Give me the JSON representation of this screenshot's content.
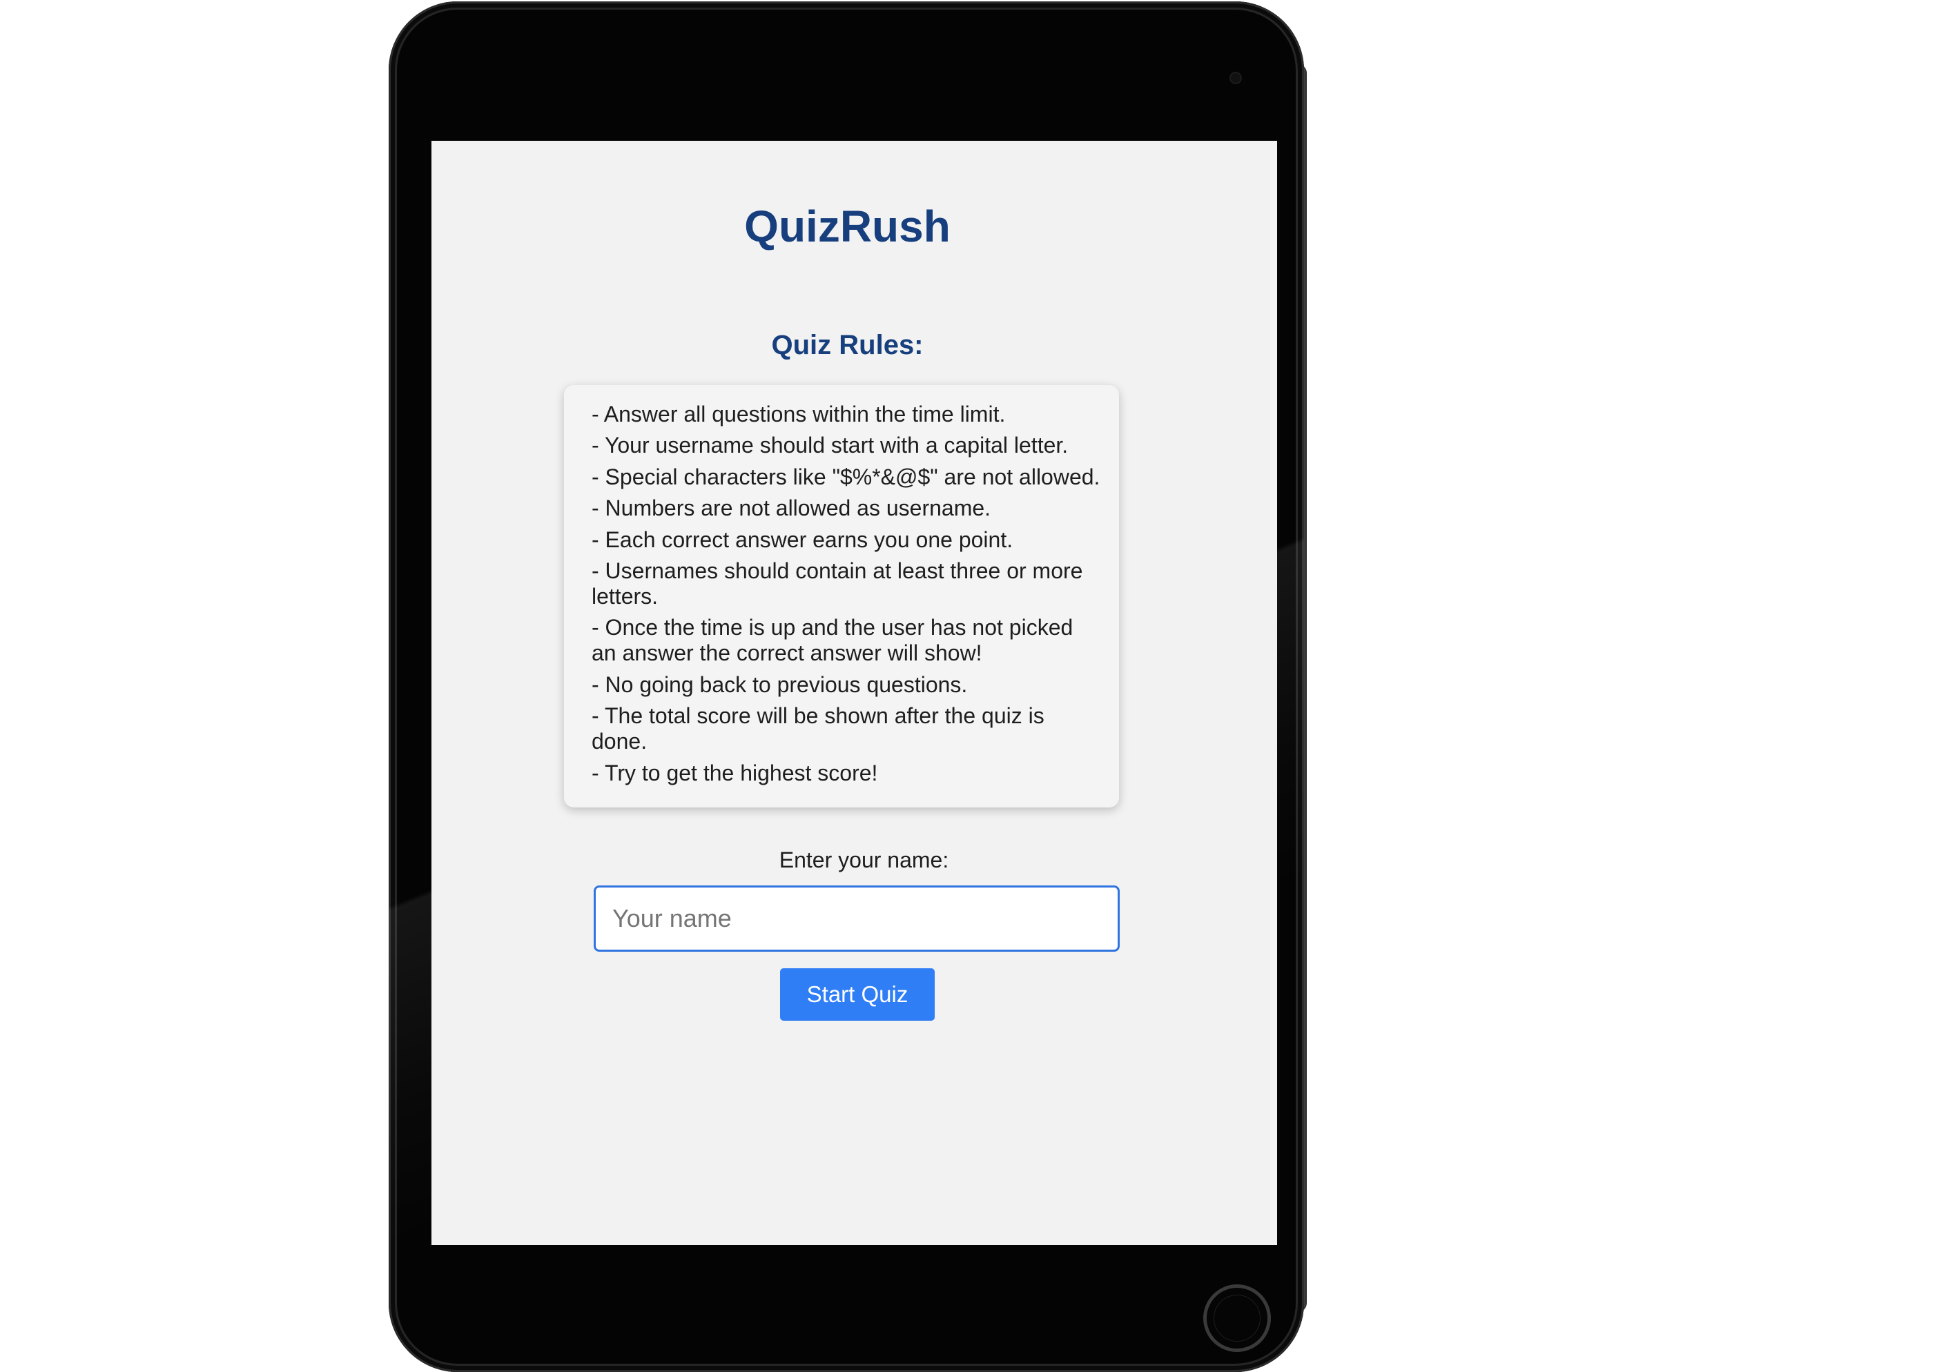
{
  "app": {
    "title": "QuizRush"
  },
  "rules": {
    "heading": "Quiz Rules:",
    "items": [
      "- Answer all questions within the time limit.",
      "- Your username should start with a capital letter.",
      "- Special characters like \"$%*&@$\" are not allowed.",
      "- Numbers are not allowed as username.",
      "- Each correct answer earns you one point.",
      "- Usernames should contain at least three or more letters.",
      "- Once the time is up and the user has not picked an answer the correct answer will show!",
      "- No going back to previous questions.",
      "- The total score will be shown after the quiz is done.",
      "- Try to get the highest score!"
    ]
  },
  "form": {
    "name_label": "Enter your name:",
    "name_value": "",
    "name_placeholder": "Your name",
    "start_label": "Start Quiz"
  },
  "device": {
    "type": "tablet",
    "home_button_icon": "home-button-icon",
    "camera_icon": "camera-icon"
  },
  "colors": {
    "title": "#173f7e",
    "input_border": "#2f74e0",
    "button_bg": "#2f7ef5",
    "screen_bg": "#f2f2f2"
  }
}
